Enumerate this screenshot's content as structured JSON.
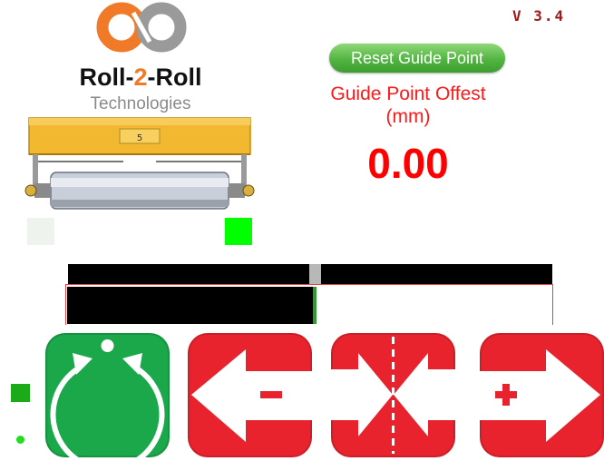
{
  "header": {
    "version": "V 3.4"
  },
  "logo": {
    "brand_part1": "Roll-",
    "brand_part2": "2",
    "brand_part3": "-Roll",
    "subtitle": "Technologies"
  },
  "machine": {
    "label": "5"
  },
  "guide": {
    "reset_label": "Reset Guide Point",
    "offset_label_line1": "Guide Point Offest",
    "offset_label_line2": "(mm)",
    "offset_value": "0.00"
  },
  "sensors": {
    "left_active": false,
    "right_active": true
  },
  "position_bar": {
    "marker_fraction": 0.51,
    "fill_fraction": 0.51
  },
  "controls": {
    "auto_icon": "auto-mode-icon",
    "left_icon": "arrow-left-minus-icon",
    "center_icon": "center-icon",
    "right_icon": "arrow-right-plus-icon"
  },
  "colors": {
    "accent_red": "#e8232d",
    "accent_green": "#1aa84a",
    "offset_red": "#ff0000",
    "sensor_on": "#00ff00"
  }
}
